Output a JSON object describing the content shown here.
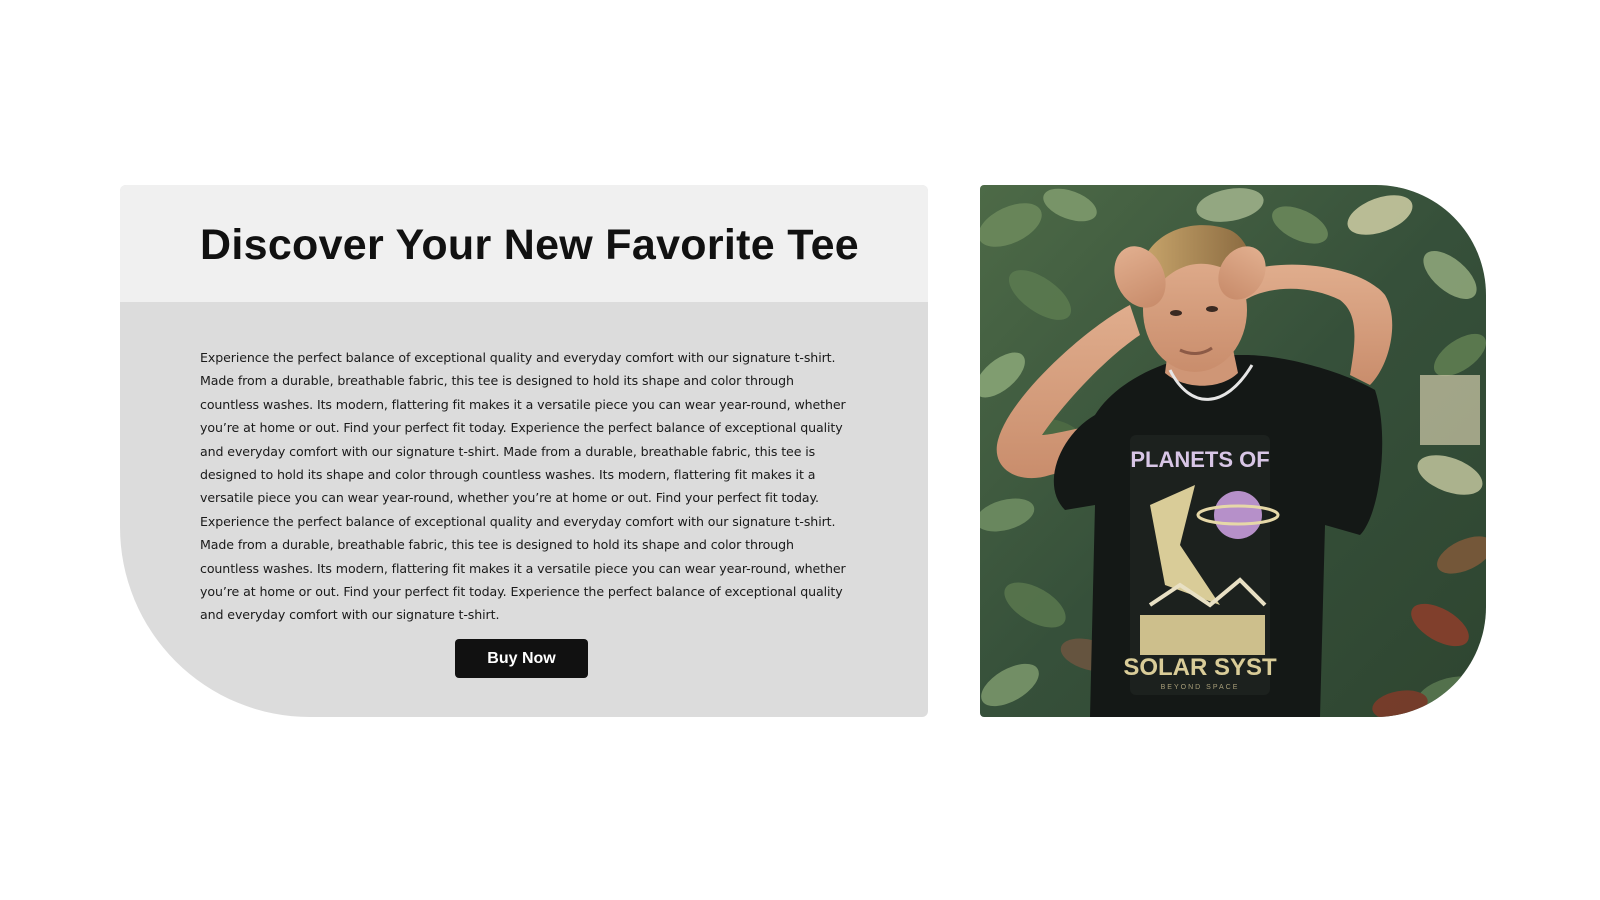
{
  "hero": {
    "title": "Discover Your New Favorite Tee",
    "description": "Experience the perfect balance of exceptional quality and everyday comfort with our signature t-shirt. Made from a durable, breathable fabric, this tee is designed to hold its shape and color through countless washes. Its modern, flattering fit makes it a versatile piece you can wear year-round, whether you’re at home or out. Find your perfect fit today. Experience the perfect balance of exceptional quality and everyday comfort with our signature t-shirt. Made from a durable, breathable fabric, this tee is designed to hold its shape and color through countless washes. Its modern, flattering fit makes it a versatile piece you can wear year-round, whether you’re at home or out. Find your perfect fit today. Experience the perfect balance of exceptional quality and everyday comfort with our signature t-shirt. Made from a durable, breathable fabric, this tee is designed to hold its shape and color through countless washes. Its modern, flattering fit makes it a versatile piece you can wear year-round, whether you’re at home or out. Find your perfect fit today. Experience the perfect balance of exceptional quality and everyday comfort with our signature t-shirt.",
    "cta_label": "Buy Now"
  },
  "photo": {
    "shirt_print_top": "PLANETS OF",
    "shirt_print_bottom": "SOLAR SYST",
    "shirt_print_small": "BEYOND SPACE"
  },
  "colors": {
    "page_background": "#ffffff",
    "card_background": "#dcdcdc",
    "card_header_background": "#f0f0f0",
    "button_background": "#111111",
    "button_text": "#ffffff",
    "foliage": "#3f5a3c"
  }
}
